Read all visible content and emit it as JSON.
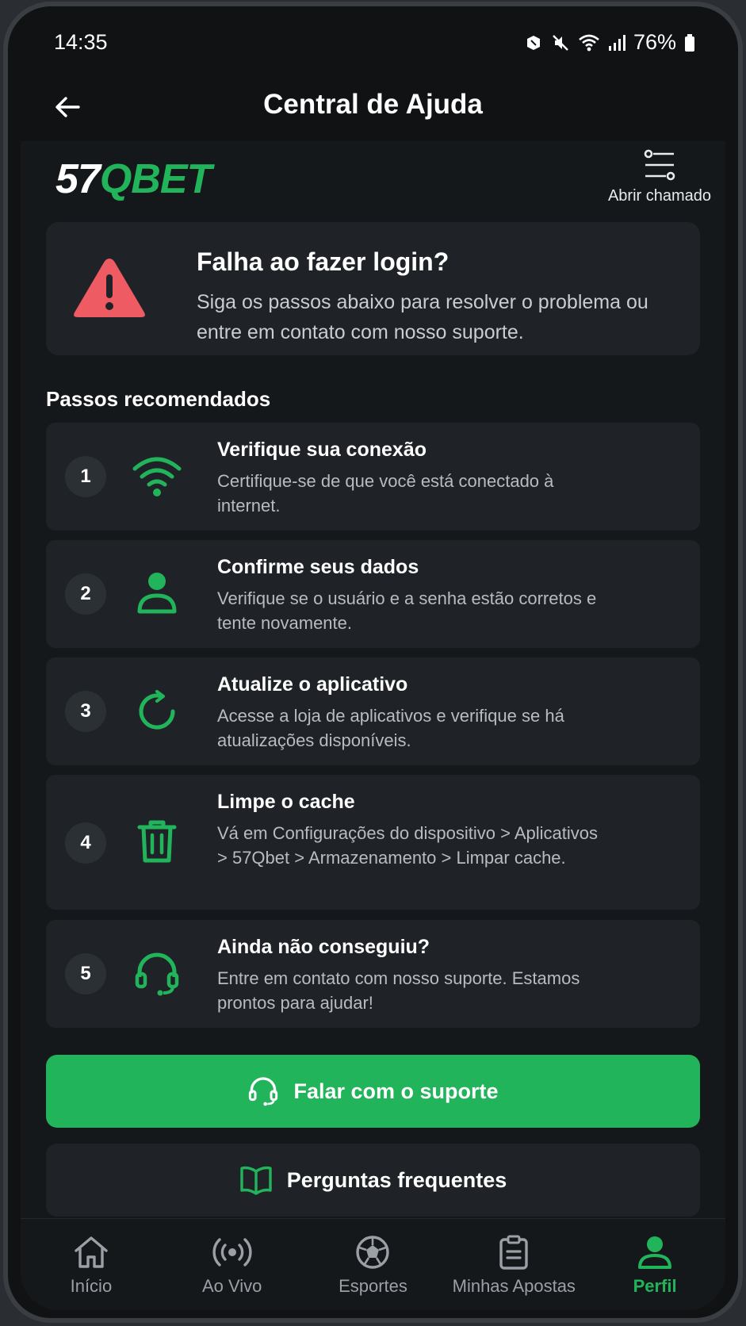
{
  "status_bar": {
    "time": "14:35",
    "battery": "76%"
  },
  "header": {
    "title": "Central de Ajuda"
  },
  "brand": {
    "logo_part1": "57",
    "logo_part2": "QBET",
    "open_ticket_label": "Abrir chamado"
  },
  "alert": {
    "title": "Falha ao fazer login?",
    "text": "Siga os passos abaixo para resolver o problema ou entre em contato com nosso suporte."
  },
  "steps_section": {
    "title": "Passos recomendados",
    "steps": [
      {
        "num": "1",
        "icon": "wifi-icon",
        "title": "Verifique sua conexão",
        "desc": "Certifique-se de que você está conectado à internet."
      },
      {
        "num": "2",
        "icon": "user-icon",
        "title": "Confirme seus dados",
        "desc": "Verifique se o usuário e a senha estão corretos e tente novamente."
      },
      {
        "num": "3",
        "icon": "refresh-icon",
        "title": "Atualize o aplicativo",
        "desc": "Acesse a loja de aplicativos e verifique se há atualizações disponíveis."
      },
      {
        "num": "4",
        "icon": "trash-icon",
        "title": "Limpe o cache",
        "desc": "Vá em Configurações do dispositivo > Aplicativos > 57Qbet > Armazenamento > Limpar cache."
      },
      {
        "num": "5",
        "icon": "headset-icon",
        "title": "Ainda não conseguiu?",
        "desc": "Entre em contato com nosso suporte. Estamos prontos para ajudar!"
      }
    ]
  },
  "actions": {
    "support_label": "Falar com o suporte",
    "faq_label": "Perguntas frequentes"
  },
  "bottom_nav": {
    "items": [
      {
        "label": "Início",
        "icon": "home-icon"
      },
      {
        "label": "Ao Vivo",
        "icon": "live-icon"
      },
      {
        "label": "Esportes",
        "icon": "soccer-ball-icon"
      },
      {
        "label": "Minhas Apostas",
        "icon": "clipboard-icon"
      },
      {
        "label": "Perfil",
        "icon": "profile-icon",
        "active": true
      }
    ]
  },
  "colors": {
    "accent": "#22b45a",
    "alert": "#ef5b63",
    "card": "#1f2327",
    "background": "#15181b"
  }
}
